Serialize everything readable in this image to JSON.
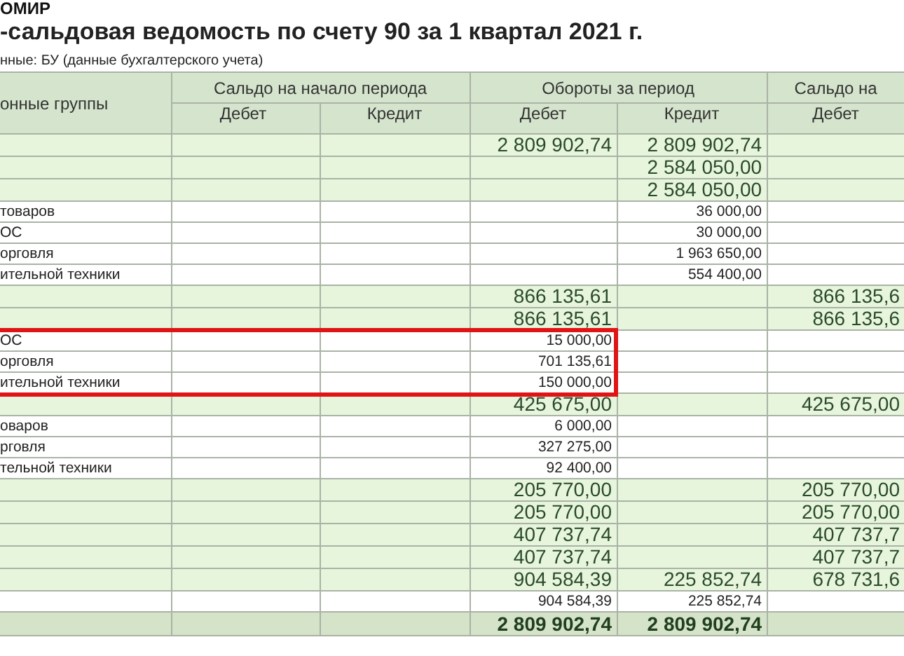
{
  "organization": "ОМИР",
  "title": "-сальдовая ведомость по счету 90 за 1 квартал 2021 г.",
  "data_source": "нные:  БУ (данные бухгалтерского учета)",
  "table": {
    "row_header": "онные группы",
    "column_groups": [
      {
        "label": "Сальдо на начало периода",
        "columns": [
          "Дебет",
          "Кредит"
        ]
      },
      {
        "label": "Обороты за период",
        "columns": [
          "Дебет",
          "Кредит"
        ]
      },
      {
        "label": "Сальдо на",
        "columns": [
          "Дебет"
        ]
      }
    ],
    "rows": [
      {
        "kind": "group",
        "highlighted": false,
        "cells": [
          null,
          null,
          "2 809 902,74",
          "2 809 902,74",
          null
        ]
      },
      {
        "kind": "group",
        "highlighted": false,
        "cells": [
          null,
          null,
          null,
          "2 584 050,00",
          null
        ]
      },
      {
        "kind": "group",
        "highlighted": false,
        "cells": [
          null,
          null,
          null,
          "2 584 050,00",
          null
        ]
      },
      {
        "kind": "detail",
        "highlighted": false,
        "label": "товаров",
        "cells": [
          null,
          null,
          null,
          "36 000,00",
          null
        ]
      },
      {
        "kind": "detail",
        "highlighted": false,
        "label": "ОС",
        "cells": [
          null,
          null,
          null,
          "30 000,00",
          null
        ]
      },
      {
        "kind": "detail",
        "highlighted": false,
        "label": "орговля",
        "cells": [
          null,
          null,
          null,
          "1 963 650,00",
          null
        ]
      },
      {
        "kind": "detail",
        "highlighted": false,
        "label": "ительной техники",
        "cells": [
          null,
          null,
          null,
          "554 400,00",
          null
        ]
      },
      {
        "kind": "group",
        "highlighted": false,
        "cells": [
          null,
          null,
          "866 135,61",
          null,
          "866 135,6"
        ]
      },
      {
        "kind": "group",
        "highlighted": false,
        "cells": [
          null,
          null,
          "866 135,61",
          null,
          "866 135,6"
        ]
      },
      {
        "kind": "detail",
        "highlighted": true,
        "label": "ОС",
        "cells": [
          null,
          null,
          "15 000,00",
          null,
          null
        ]
      },
      {
        "kind": "detail",
        "highlighted": true,
        "label": "орговля",
        "cells": [
          null,
          null,
          "701 135,61",
          null,
          null
        ]
      },
      {
        "kind": "detail",
        "highlighted": true,
        "label": "ительной техники",
        "cells": [
          null,
          null,
          "150 000,00",
          null,
          null
        ]
      },
      {
        "kind": "group",
        "highlighted": false,
        "cells": [
          null,
          null,
          "425 675,00",
          null,
          "425 675,00"
        ]
      },
      {
        "kind": "detail",
        "highlighted": false,
        "label": "оваров",
        "cells": [
          null,
          null,
          "6 000,00",
          null,
          null
        ]
      },
      {
        "kind": "detail",
        "highlighted": false,
        "label": "рговля",
        "cells": [
          null,
          null,
          "327 275,00",
          null,
          null
        ]
      },
      {
        "kind": "detail",
        "highlighted": false,
        "label": "тельной техники",
        "cells": [
          null,
          null,
          "92 400,00",
          null,
          null
        ]
      },
      {
        "kind": "group",
        "highlighted": false,
        "cells": [
          null,
          null,
          "205 770,00",
          null,
          "205 770,00"
        ]
      },
      {
        "kind": "group",
        "highlighted": false,
        "cells": [
          null,
          null,
          "205 770,00",
          null,
          "205 770,00"
        ]
      },
      {
        "kind": "group",
        "highlighted": false,
        "cells": [
          null,
          null,
          "407 737,74",
          null,
          "407 737,7"
        ]
      },
      {
        "kind": "group",
        "highlighted": false,
        "cells": [
          null,
          null,
          "407 737,74",
          null,
          "407 737,7"
        ]
      },
      {
        "kind": "group",
        "highlighted": false,
        "cells": [
          null,
          null,
          "904 584,39",
          "225 852,74",
          "678 731,6"
        ]
      },
      {
        "kind": "detail",
        "highlighted": false,
        "cells": [
          null,
          null,
          "904 584,39",
          "225 852,74",
          null
        ]
      },
      {
        "kind": "total",
        "highlighted": false,
        "cells": [
          null,
          null,
          "2 809 902,74",
          "2 809 902,74",
          null
        ]
      }
    ]
  }
}
